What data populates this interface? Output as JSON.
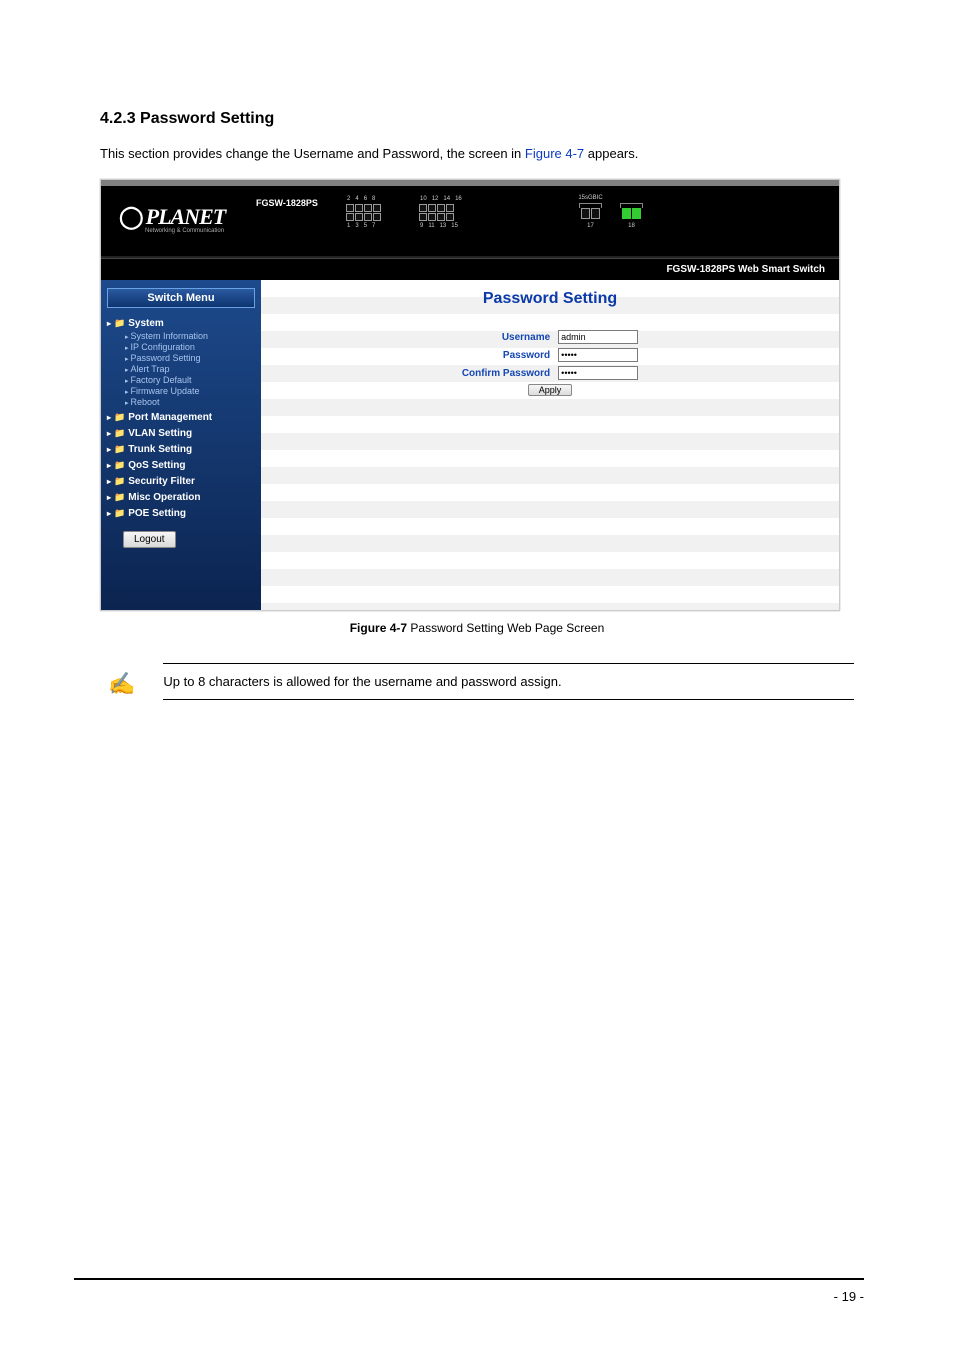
{
  "section_heading": "4.2.3 Password Setting",
  "intro_pre": "This section provides change the Username and Password, the screen in ",
  "figref": "Figure 4-7",
  "intro_post": " appears.",
  "device": {
    "brand": "PLANET",
    "brand_sub": "Networking & Communication",
    "model": "FGSW-1828PS",
    "ports_top": [
      "2",
      "4",
      "6",
      "8",
      "10",
      "12",
      "14",
      "16"
    ],
    "ports_bot": [
      "1",
      "3",
      "5",
      "7",
      "9",
      "11",
      "13",
      "15"
    ],
    "fiber_label": "15sGBIC",
    "fiber_nums": [
      "17",
      "18"
    ],
    "smart_title": "FGSW-1828PS Web Smart Switch"
  },
  "sidebar": {
    "title": "Switch Menu",
    "cats": [
      {
        "label": "System",
        "subs": [
          "System Information",
          "IP Configuration",
          "Password Setting",
          "Alert Trap",
          "Factory Default",
          "Firmware Update",
          "Reboot"
        ]
      },
      {
        "label": "Port Management"
      },
      {
        "label": "VLAN Setting"
      },
      {
        "label": "Trunk Setting"
      },
      {
        "label": "QoS Setting"
      },
      {
        "label": "Security Filter"
      },
      {
        "label": "Misc Operation"
      },
      {
        "label": "POE Setting"
      }
    ],
    "logout": "Logout"
  },
  "form": {
    "heading": "Password Setting",
    "rows": [
      {
        "label": "Username",
        "value": "admin",
        "type": "text"
      },
      {
        "label": "Password",
        "value": "*****",
        "type": "password"
      },
      {
        "label": "Confirm Password",
        "value": "*****",
        "type": "password"
      }
    ],
    "apply": "Apply"
  },
  "caption_bold": "Figure 4-7",
  "caption_rest": " Password Setting Web Page Screen",
  "note_text": "Up to 8 characters is allowed for the username and password assign.",
  "page_number": "- 19 -"
}
